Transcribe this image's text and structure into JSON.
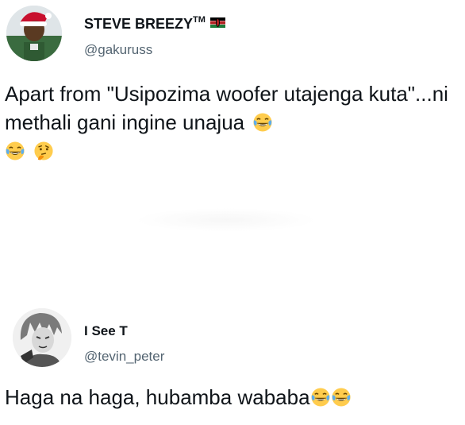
{
  "tweets": [
    {
      "display_name": "STEVE BREEZY",
      "tm": "TM",
      "handle": "@gakuruss",
      "text": "Apart from \"Usipozima woofer utajenga kuta\"...ni methali gani ingine unajua",
      "emojis": [
        "face-with-tears-of-joy",
        "face-with-tears-of-joy",
        "thinking-face"
      ],
      "flag": "kenya-flag"
    },
    {
      "display_name": "I See T",
      "handle": "@tevin_peter",
      "text": "Haga na haga, hubamba wababa",
      "emojis": [
        "face-with-tears-of-joy",
        "face-with-tears-of-joy"
      ]
    }
  ],
  "colors": {
    "text": "#0f1419",
    "handle": "#536471",
    "emoji_face": "#ffcc4d",
    "tears": "#5dadec"
  }
}
